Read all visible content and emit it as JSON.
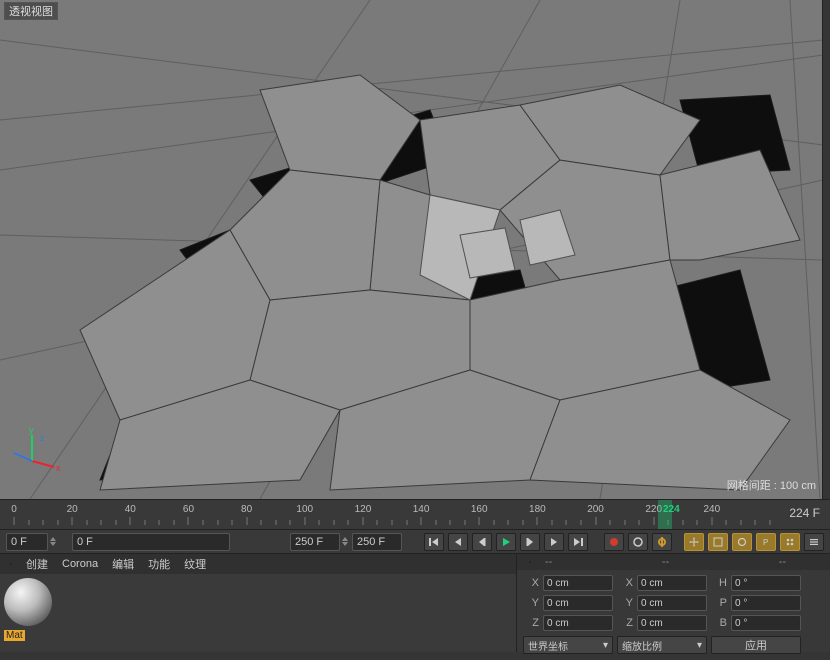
{
  "viewport": {
    "label": "透视视图",
    "grid_info": "网格间距 : 100 cm"
  },
  "axis": {
    "x": "x",
    "y": "y",
    "z": "z"
  },
  "timeline": {
    "ticks": [
      0,
      20,
      40,
      60,
      80,
      100,
      120,
      140,
      160,
      180,
      200,
      220,
      240
    ],
    "current_frame": 224,
    "frame_display": "224 F",
    "start_label": "0 F",
    "start_field": "0 F",
    "end_field": "250 F",
    "end_label": "250 F"
  },
  "transport": {
    "rewind": "rewind-icon",
    "back": "back-icon",
    "prev": "prev-icon",
    "play": "play-icon",
    "next": "next-icon",
    "forward": "forward-icon",
    "end": "end-icon"
  },
  "material": {
    "menu": [
      "创建",
      "Corona",
      "编辑",
      "功能",
      "纹理"
    ],
    "name": "Mat"
  },
  "coord": {
    "dashes1": "--",
    "dashes2": "--",
    "dashes3": "--",
    "rows": [
      {
        "l1": "X",
        "v1": "0 cm",
        "l2": "X",
        "v2": "0 cm",
        "l3": "H",
        "v3": "0 °"
      },
      {
        "l1": "Y",
        "v1": "0 cm",
        "l2": "Y",
        "v2": "0 cm",
        "l3": "P",
        "v3": "0 °"
      },
      {
        "l1": "Z",
        "v1": "0 cm",
        "l2": "Z",
        "v2": "0 cm",
        "l3": "B",
        "v3": "0 °"
      }
    ],
    "dropdown1": "世界坐标",
    "dropdown2": "缩放比例",
    "apply": "应用"
  }
}
